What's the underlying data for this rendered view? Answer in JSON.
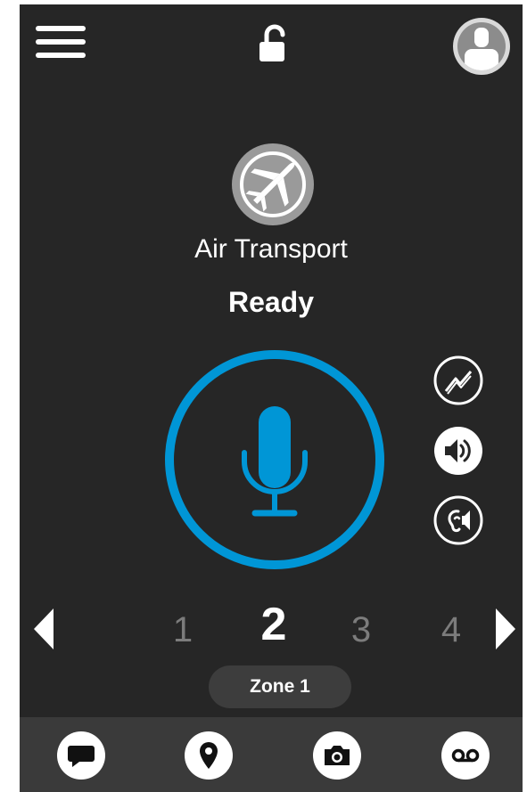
{
  "header": {
    "menu_icon": "hamburger-menu-icon",
    "lock_icon": "unlocked-padlock-icon",
    "avatar_icon": "user-avatar-icon"
  },
  "channel": {
    "icon": "airplane-icon",
    "name": "Air Transport",
    "status": "Ready"
  },
  "ptt": {
    "icon": "microphone-icon",
    "ring_color": "#0096d6"
  },
  "side_actions": [
    {
      "icon": "signal-trend-icon"
    },
    {
      "icon": "speaker-volume-icon"
    },
    {
      "icon": "earpiece-speaker-icon"
    }
  ],
  "channel_selector": {
    "prev_icon": "caret-left-icon",
    "next_icon": "caret-right-icon",
    "numbers": [
      "1",
      "2",
      "3",
      "4"
    ],
    "active": "2"
  },
  "zone": {
    "label": "Zone 1"
  },
  "bottom_bar": [
    {
      "icon": "chat-bubble-icon"
    },
    {
      "icon": "location-pin-icon"
    },
    {
      "icon": "camera-icon"
    },
    {
      "icon": "voicemail-icon"
    }
  ],
  "colors": {
    "background": "#262626",
    "bottom_bar": "#3a3a3a",
    "accent": "#0096d6",
    "muted_number": "#7c7c7c"
  }
}
